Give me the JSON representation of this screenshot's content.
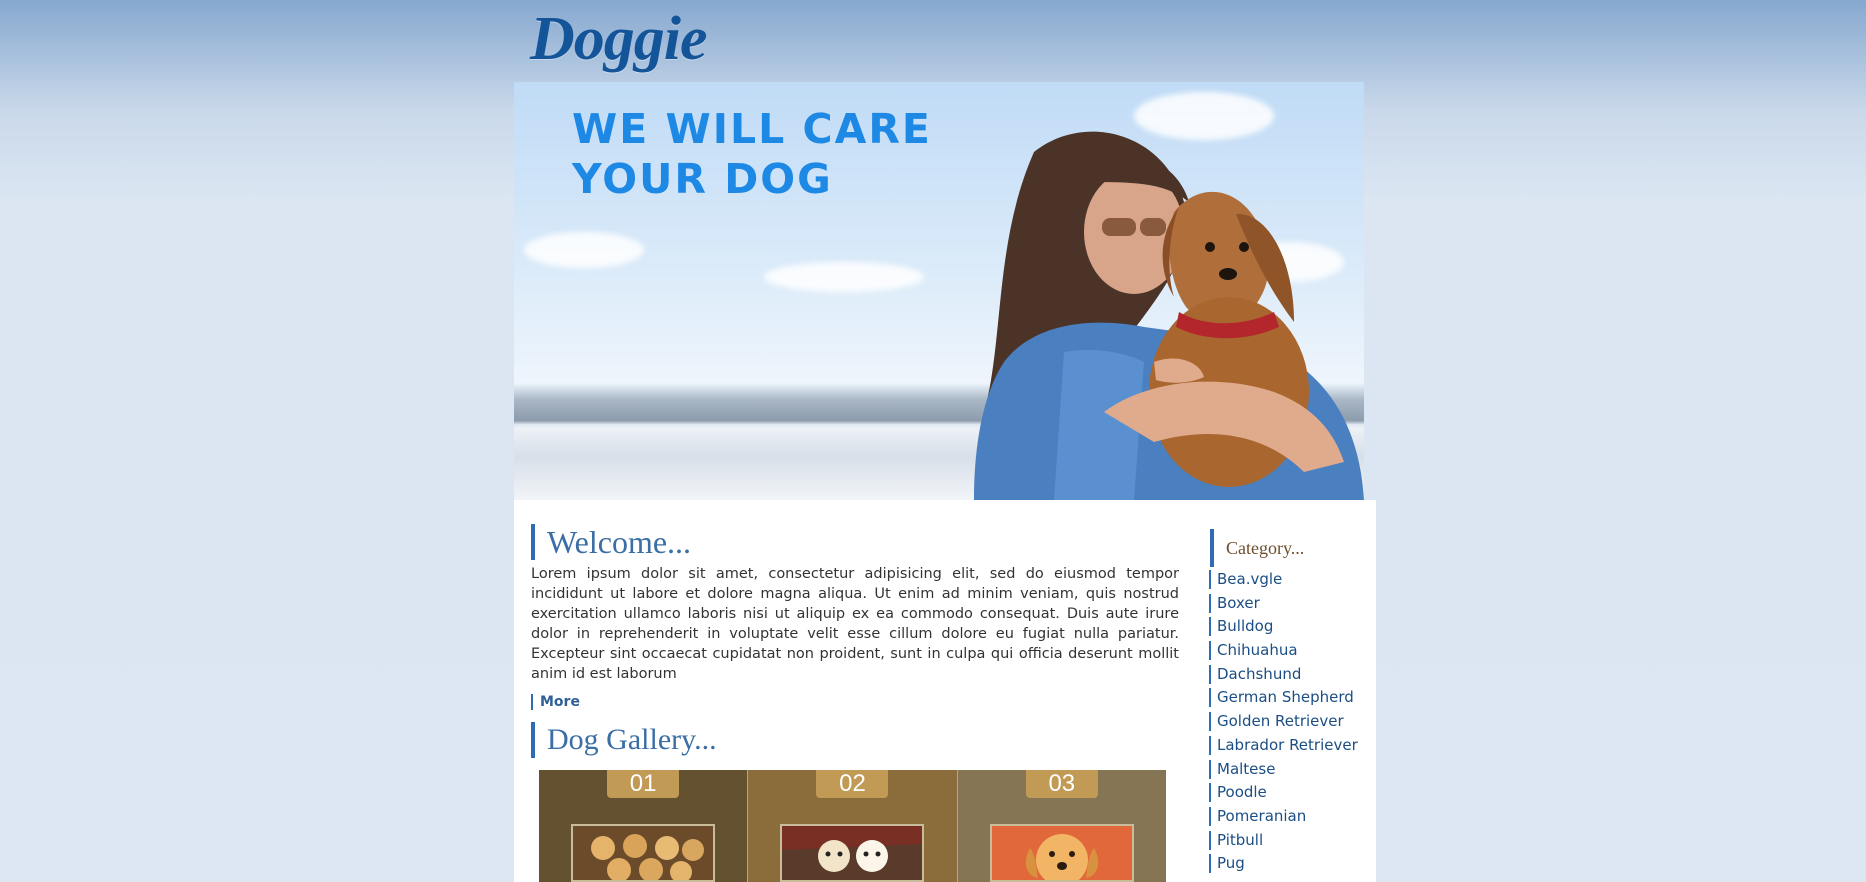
{
  "site": {
    "logo": "Doggie"
  },
  "hero": {
    "tagline": "WE WILL CARE YOUR DOG"
  },
  "welcome": {
    "title": "Welcome...",
    "body": "Lorem ipsum dolor sit amet, consectetur adipisicing elit, sed do eiusmod tempor incididunt ut labore et dolore magna aliqua. Ut enim ad minim veniam, quis nostrud exercitation ullamco laboris nisi ut aliquip ex ea commodo consequat. Duis aute irure dolor in reprehenderit in voluptate velit esse cillum dolore eu fugiat nulla pariatur. Excepteur sint occaecat cupidatat non proident, sunt in culpa qui officia deserunt mollit anim id est laborum",
    "more_label": "More"
  },
  "gallery": {
    "title": "Dog Gallery...",
    "items": [
      {
        "number": "01",
        "color": "#63512f"
      },
      {
        "number": "02",
        "color": "#8b6d3c"
      },
      {
        "number": "03",
        "color": "#857554"
      }
    ]
  },
  "sidebar": {
    "title": "Category...",
    "categories": [
      "Bea.vgle",
      "Boxer",
      "Bulldog",
      "Chihuahua",
      "Dachshund",
      "German Shepherd",
      "Golden Retriever",
      "Labrador Retriever",
      "Maltese",
      "Poodle",
      "Pomeranian",
      "Pitbull",
      "Pug"
    ]
  },
  "colors": {
    "accent": "#2f6cb3",
    "link": "#1b4e84",
    "hero_text": "#1e88e5"
  }
}
